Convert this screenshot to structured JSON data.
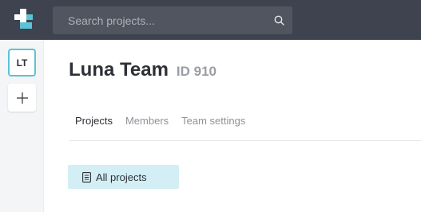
{
  "header": {
    "logo_icon": "app-logo-icon",
    "search": {
      "placeholder": "Search projects...",
      "value": "",
      "icon": "search-icon"
    }
  },
  "sidebar": {
    "team_initials": "LT",
    "add_icon": "plus-icon"
  },
  "team": {
    "name": "Luna Team",
    "id_label": "ID 910"
  },
  "tabs": [
    {
      "label": "Projects",
      "active": true
    },
    {
      "label": "Members",
      "active": false
    },
    {
      "label": "Team settings",
      "active": false
    }
  ],
  "filter": {
    "label": "All projects",
    "icon": "document-icon"
  },
  "colors": {
    "topbar": "#3e434f",
    "accent": "#5cc2d6",
    "filter_bg": "#d3eef5"
  }
}
